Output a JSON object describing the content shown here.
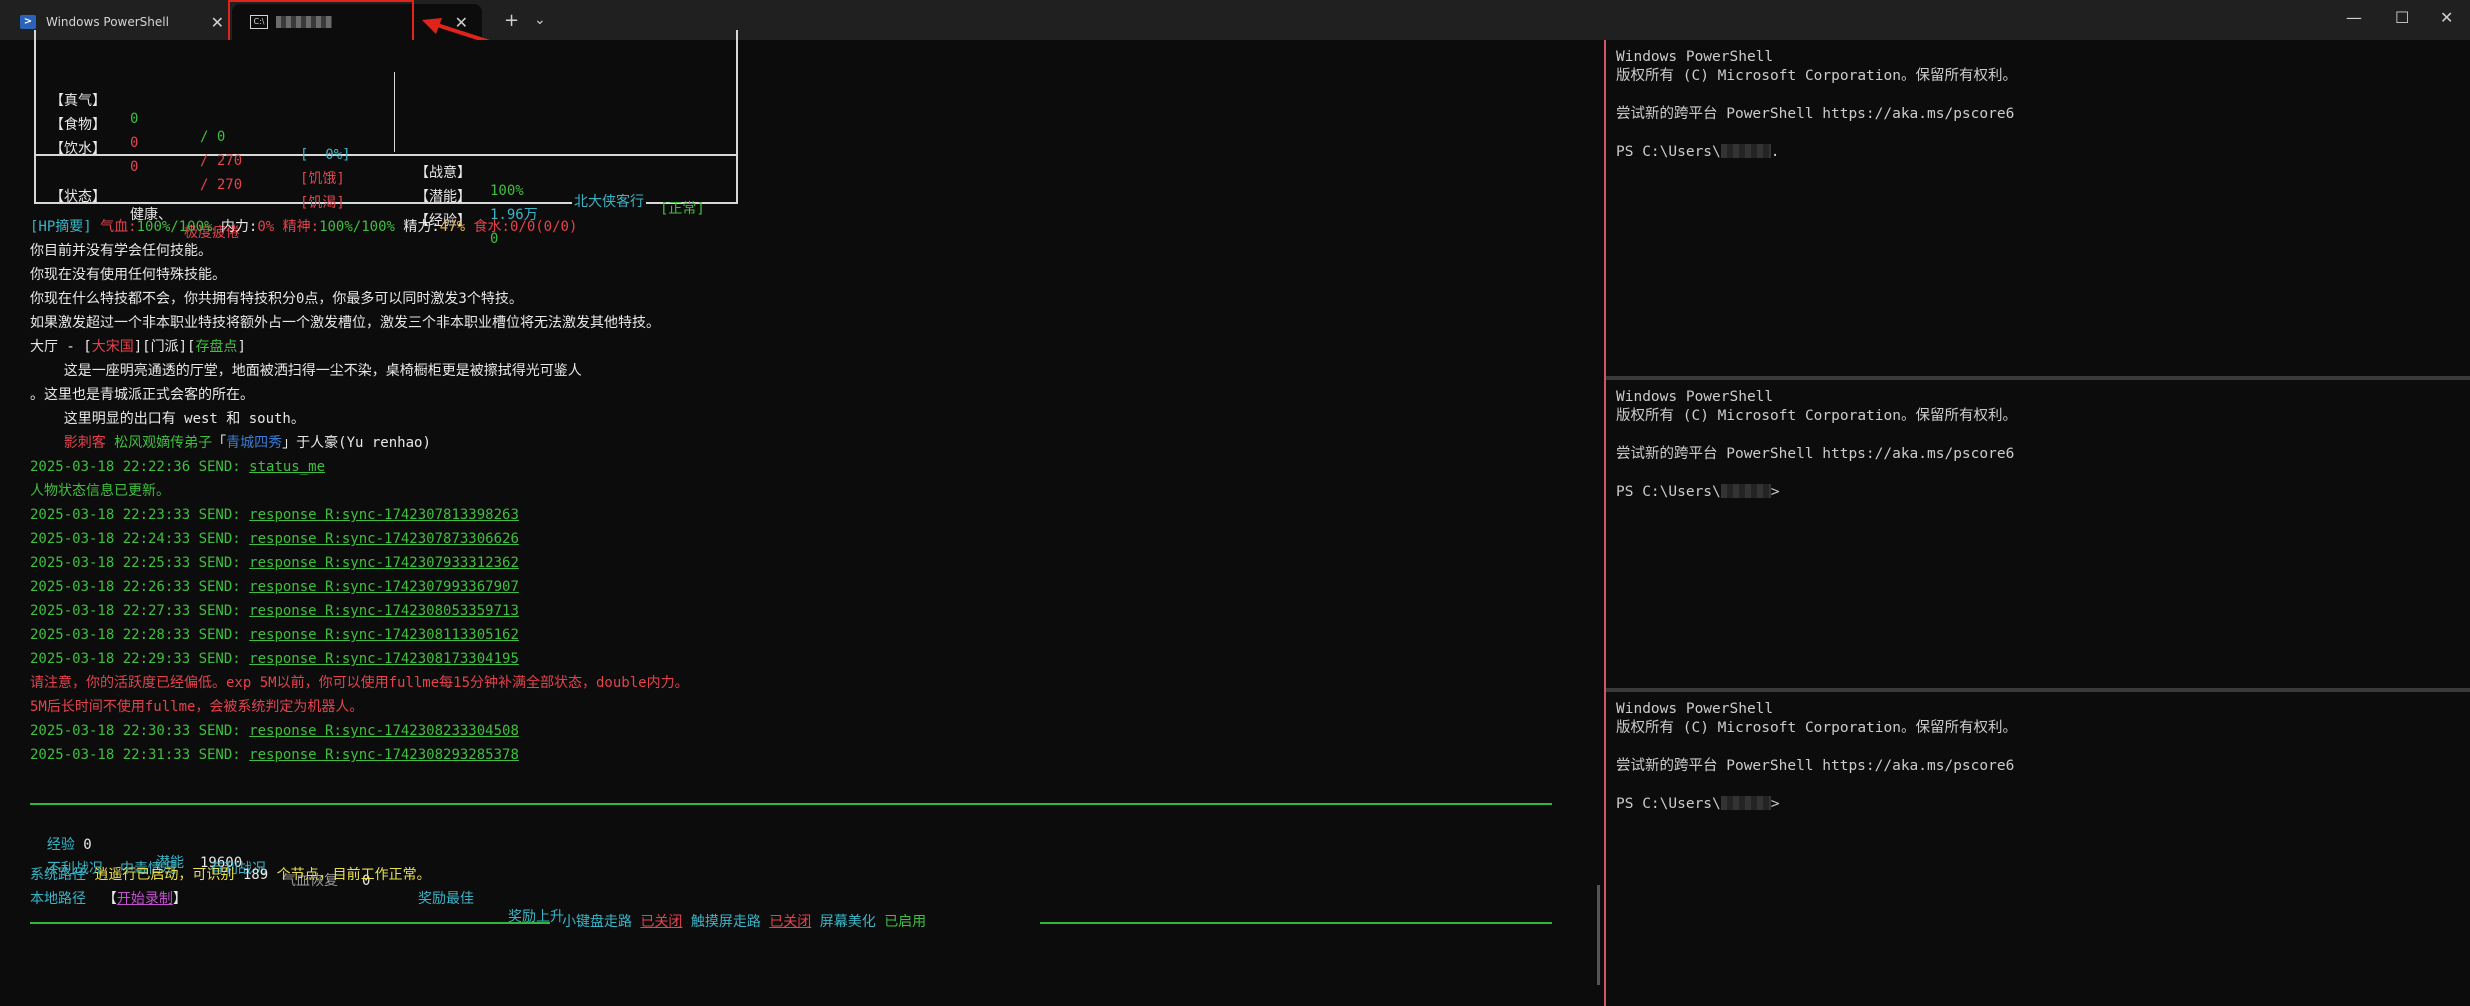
{
  "tabs": [
    {
      "title": "Windows PowerShell"
    },
    {
      "title": ""
    }
  ],
  "titlebar": {
    "new_tab": "+",
    "dropdown": "⌄",
    "minimize": "—",
    "maximize": "☐",
    "close": "✕"
  },
  "status_box": {
    "r1": {
      "a": "【真气】",
      "b": "0",
      "c": "/ 0",
      "d": "[  0%]",
      "e": "【战意】",
      "f": "100%",
      "g": "[正常]"
    },
    "r2": {
      "a": "【食物】",
      "b": "0",
      "c": "/ 270",
      "d": "[饥饿]",
      "e": "【潜能】",
      "f": "1.96万"
    },
    "r3": {
      "a": "【饮水】",
      "b": "0",
      "c": "/ 270",
      "d": "[饥渴]",
      "e": "【经验】",
      "f": "0"
    },
    "state": {
      "a": "【状态】",
      "b": "健康、",
      "c": "极度疲倦"
    },
    "caption": "北大侠客行"
  },
  "hp": {
    "a": "[HP摘要]",
    "b": "气血:",
    "c": "100%/100%",
    "d": "内力:",
    "e": "0%",
    "f": "精神:",
    "g": "100%/100%",
    "h": "精力:",
    "i": "47%",
    "j": "食水:",
    "k": "0/0(0/0)"
  },
  "text_lines": {
    "l1": "你目前并没有学会任何技能。",
    "l2": "你现在没有使用任何特殊技能。",
    "l3": "你现在什么特技都不会，你共拥有特技积分0点，你最多可以同时激发3个特技。",
    "l4": "如果激发超过一个非本职业特技将额外占一个激发槽位，激发三个非本职业槽位将无法激发其他特技。"
  },
  "room": {
    "a": "大厅 - [",
    "b": "大宋国",
    "c": "][门派][",
    "d": "存盘点",
    "e": "]",
    "desc1": "    这是一座明亮通透的厅堂，地面被洒扫得一尘不染，桌椅橱柜更是被擦拭得光可鉴人",
    "desc2": "。这里也是青城派正式会客的所在。",
    "exits": "    这里明显的出口有 west 和 south。",
    "npc_a": "    影刺客 ",
    "npc_b": "松风观嫡传弟子",
    "npc_c": "「",
    "npc_d": "青城四秀",
    "npc_e": "」于人豪(Yu renhao)"
  },
  "log": [
    {
      "time": "2025-03-18 22:22:36 SEND: ",
      "cmd": "status_me"
    },
    {
      "msg": "人物状态信息已更新。"
    },
    {
      "time": "2025-03-18 22:23:33 SEND: ",
      "cmd": "response R:sync-1742307813398263"
    },
    {
      "time": "2025-03-18 22:24:33 SEND: ",
      "cmd": "response R:sync-1742307873306626"
    },
    {
      "time": "2025-03-18 22:25:33 SEND: ",
      "cmd": "response R:sync-1742307933312362"
    },
    {
      "time": "2025-03-18 22:26:33 SEND: ",
      "cmd": "response R:sync-1742307993367907"
    },
    {
      "time": "2025-03-18 22:27:33 SEND: ",
      "cmd": "response R:sync-1742308053359713"
    },
    {
      "time": "2025-03-18 22:28:33 SEND: ",
      "cmd": "response R:sync-1742308113305162"
    },
    {
      "time": "2025-03-18 22:29:33 SEND: ",
      "cmd": "response R:sync-1742308173304195"
    },
    {
      "warn": "请注意，你的活跃度已经偏低。exp 5M以前，你可以使用fullme每15分钟补满全部状态，double内力。"
    },
    {
      "warn": "5M后长时间不使用fullme，会被系统判定为机器人。"
    },
    {
      "time": "2025-03-18 22:30:33 SEND: ",
      "cmd": "response R:sync-1742308233304508"
    },
    {
      "time": "2025-03-18 22:31:33 SEND: ",
      "cmd": "response R:sync-1742308293285378"
    }
  ],
  "bottom": {
    "exp_l": "经验",
    "exp_v": "0",
    "pot_l": "潜能",
    "pot_v": "19600",
    "hp_l": "气血恢复",
    "hp_v": "0",
    "rew1": "奖励最佳",
    "rew2": "奖励上升",
    "c1": "不利战况",
    "c2": "中毒情况",
    "c3": "有利战况",
    "sys_l": "系统路径",
    "sys_a": "逍遥行已启动，可识别 ",
    "sys_n": "189",
    "sys_b": " 个节点，目前工作正常。",
    "loc_l": "本地路径",
    "loc_a": "【",
    "loc_b": "开始录制",
    "loc_c": "】",
    "f_a": "小键盘走路",
    "f_b": "已关闭",
    "f_c": "触摸屏走路",
    "f_d": "已关闭",
    "f_e": "屏幕美化",
    "f_f": "已启用"
  },
  "ps": {
    "l1": "Windows PowerShell",
    "l2": "版权所有 (C) Microsoft Corporation。保留所有权利。",
    "l3": "尝试新的跨平台 PowerShell https://aka.ms/pscore6",
    "prompt": "PS C:\\Users\\",
    "suffix1": ".",
    "suffix2": "> ",
    "suffix3": "> "
  }
}
